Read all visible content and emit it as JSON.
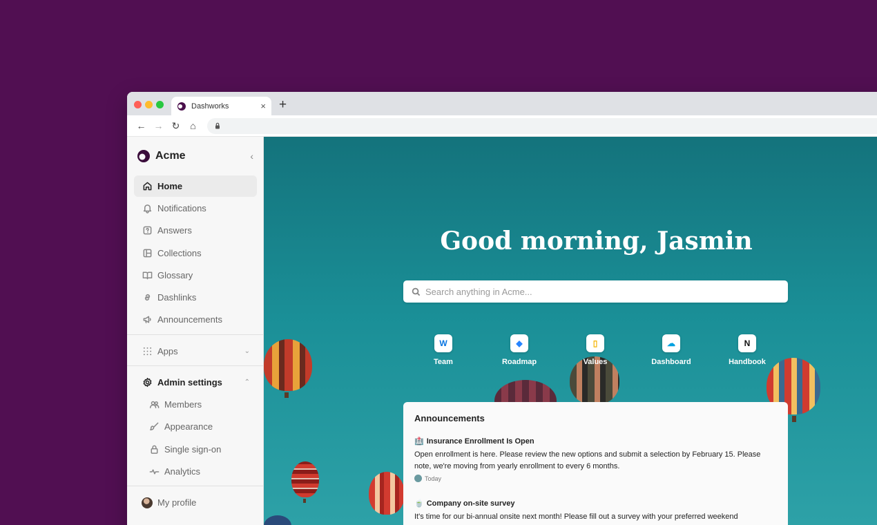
{
  "browser": {
    "tab_title": "Dashworks",
    "tab_close": "×",
    "new_tab": "+",
    "nav": {
      "back": "←",
      "forward": "→",
      "reload": "↻",
      "home": "⌂"
    }
  },
  "sidebar": {
    "brand": "Acme",
    "collapse": "‹",
    "items": [
      {
        "label": "Home",
        "icon": "home-icon"
      },
      {
        "label": "Notifications",
        "icon": "bell-icon"
      },
      {
        "label": "Answers",
        "icon": "answer-icon"
      },
      {
        "label": "Collections",
        "icon": "collection-icon"
      },
      {
        "label": "Glossary",
        "icon": "book-icon"
      },
      {
        "label": "Dashlinks",
        "icon": "link-icon"
      },
      {
        "label": "Announcements",
        "icon": "megaphone-icon"
      }
    ],
    "apps": {
      "label": "Apps",
      "icon": "grid-icon",
      "chevron": "⌄"
    },
    "admin": {
      "label": "Admin settings",
      "icon": "gear-icon",
      "chevron": "⌃",
      "items": [
        {
          "label": "Members",
          "icon": "users-icon"
        },
        {
          "label": "Appearance",
          "icon": "brush-icon"
        },
        {
          "label": "Single sign-on",
          "icon": "lock-icon"
        },
        {
          "label": "Analytics",
          "icon": "pulse-icon"
        }
      ]
    },
    "profile": {
      "label": "My profile"
    }
  },
  "main": {
    "greeting": "Good morning, Jasmin",
    "search_placeholder": "Search anything in Acme...",
    "shortcuts": [
      {
        "label": "Team",
        "icon": "workday-icon",
        "glyph": "W",
        "color": "#0875e1"
      },
      {
        "label": "Roadmap",
        "icon": "jira-icon",
        "glyph": "◆",
        "color": "#2684ff"
      },
      {
        "label": "Values",
        "icon": "docs-icon",
        "glyph": "▯",
        "color": "#f4b400"
      },
      {
        "label": "Dashboard",
        "icon": "salesforce-icon",
        "glyph": "☁",
        "color": "#00a1e0"
      },
      {
        "label": "Handbook",
        "icon": "notion-icon",
        "glyph": "N",
        "color": "#111111"
      }
    ],
    "announcements": {
      "title": "Announcements",
      "items": [
        {
          "emoji": "🏥",
          "title": "Insurance Enrollment Is Open",
          "body": "Open enrollment is here. Please review the new options and submit a selection by February 15. Please note, we're moving from yearly enrollment to every 6 months.",
          "meta": "Today"
        },
        {
          "emoji": "🍵",
          "title": "Company on-site survey",
          "body": "It's time for our bi-annual onsite next month! Please fill out a survey with your preferred weekend"
        }
      ]
    }
  }
}
